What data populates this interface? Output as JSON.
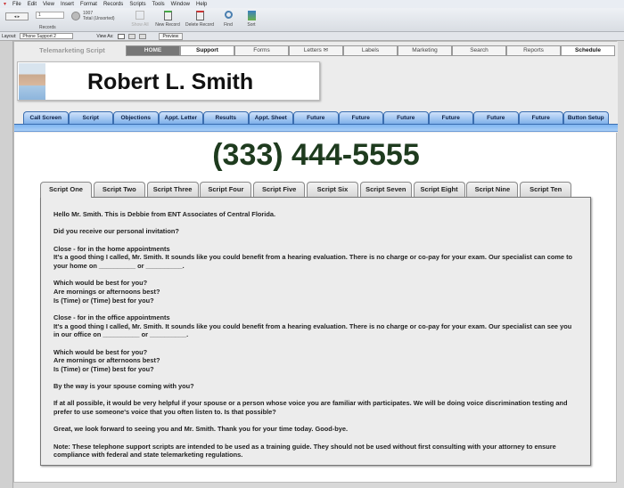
{
  "menu": [
    "File",
    "Edit",
    "View",
    "Insert",
    "Format",
    "Records",
    "Scripts",
    "Tools",
    "Window",
    "Help"
  ],
  "toolbar": {
    "record_number": "1",
    "records_label": "Records",
    "total": "1007",
    "total_label": "Total (Unsorted)",
    "show_all": "Show All",
    "new_record": "New Record",
    "delete_record": "Delete Record",
    "find": "Find",
    "sort": "Sort"
  },
  "layoutbar": {
    "layout_label": "Layout:",
    "layout_value": "Phone Support 2",
    "view_as": "View As:",
    "preview": "Preview"
  },
  "nav": {
    "title": "Telemarketing Script",
    "items": [
      "HOME",
      "Support",
      "Forms",
      "Letters",
      "Labels",
      "Marketing",
      "Search",
      "Reports",
      "Schedule"
    ]
  },
  "contact": {
    "name": "Robert L. Smith",
    "phone": "(333) 444-5555"
  },
  "button_tabs": [
    "Call Screen",
    "Script",
    "Objections",
    "Appt. Letter",
    "Results",
    "Appt. Sheet",
    "Future",
    "Future",
    "Future",
    "Future",
    "Future",
    "Future",
    "Button Setup"
  ],
  "script_tabs": [
    "Script One",
    "Script Two",
    "Script Three",
    "Script Four",
    "Script Five",
    "Script Six",
    "Script Seven",
    "Script Eight",
    "Script Nine",
    "Script Ten"
  ],
  "active_script_tab": "Script One",
  "colors": {
    "phone": "#1e3b1e",
    "tab_blue": "#7fb0ea",
    "home_bg": "#777777"
  },
  "script": [
    [
      "Hello Mr. Smith. This is Debbie from ENT Associates of Central Florida."
    ],
    [
      "Did you receive our personal invitation?"
    ],
    [
      "Close - for in the home appointments",
      "It's a good thing I called, Mr. Smith. It sounds like you could benefit from a hearing evaluation. There is no charge or co-pay for your exam. Our specialist can come to your home on __________ or __________."
    ],
    [
      "Which would be best for you?",
      "Are mornings or afternoons best?",
      "Is  (Time)  or  (Time)  best for you?"
    ],
    [
      "Close - for in the office appointments",
      "It's a good thing I called, Mr. Smith. It sounds like you could benefit from a hearing evaluation. There is no charge or co-pay for your exam. Our specialist can see you in our office on __________ or __________."
    ],
    [
      "Which would be best for you?",
      "Are mornings or afternoons best?",
      "Is  (Time)  or  (Time)  best for you?"
    ],
    [
      "By the way is your spouse coming with you?"
    ],
    [
      "If at all possible, it would be very helpful if your spouse or a person whose voice you are familiar with participates. We will be doing voice discrimination testing and prefer to use someone's voice that you often listen to.  Is that possible?"
    ],
    [
      "Great, we look forward to seeing you and Mr. Smith. Thank you for your time today. Good-bye."
    ],
    [
      "Note: These telephone support scripts are intended to be used as a training guide. They should not be used without first consulting with your attorney to ensure compliance with federal and state telemarketing regulations."
    ]
  ]
}
